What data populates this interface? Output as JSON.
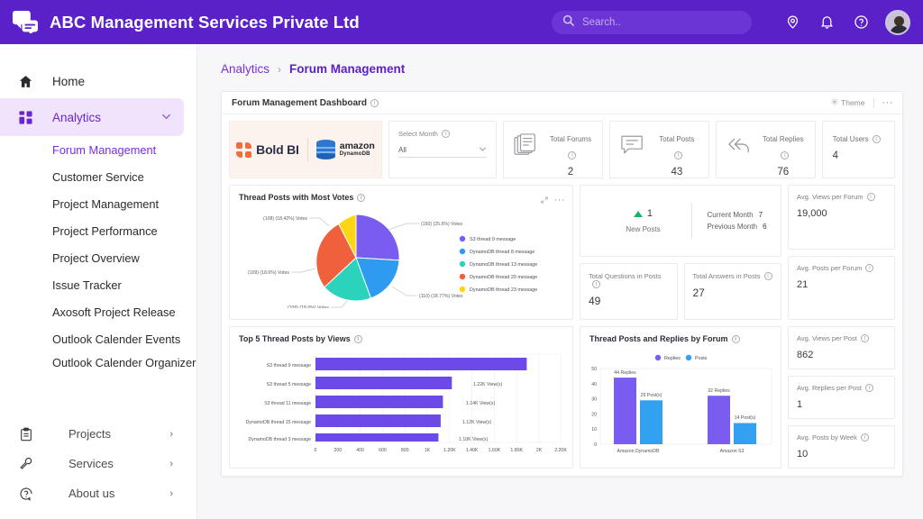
{
  "topbar": {
    "brand_title": "ABC Management Services Private Ltd",
    "search_placeholder": "Search..",
    "icons": [
      "location-pin-icon",
      "bell-icon",
      "help-icon"
    ]
  },
  "sidebar": {
    "home_label": "Home",
    "analytics_label": "Analytics",
    "sub_items": [
      "Forum Management",
      "Customer Service",
      "Project Management",
      "Project Performance",
      "Project Overview",
      "Issue Tracker",
      "Axosoft Project Release",
      "Outlook Calender Events",
      "Outlook Calender Organizer"
    ],
    "bottom_items": [
      "Projects",
      "Services",
      "About us"
    ]
  },
  "breadcrumb": {
    "parent": "Analytics",
    "separator": "›",
    "current": "Forum Management"
  },
  "dashboard": {
    "title": "Forum Management Dashboard",
    "theme_label": "Theme",
    "more_label": "···"
  },
  "kpi": {
    "logo_boldbi": "Bold BI",
    "logo_amazon": "amazon",
    "logo_dynamodb": "DynamoDB",
    "select_month_label": "Select Month",
    "select_month_value": "All",
    "cards": [
      {
        "label": "Total Forums",
        "value": "2",
        "icon": "documents-icon"
      },
      {
        "label": "Total Posts",
        "value": "43",
        "icon": "comment-icon"
      },
      {
        "label": "Total Replies",
        "value": "76",
        "icon": "reply-all-icon"
      },
      {
        "label": "Total Users",
        "value": "4",
        "icon": "none"
      }
    ]
  },
  "new_posts": {
    "value": "1",
    "label": "New Posts",
    "current_month_label": "Current Month",
    "current_month_value": "7",
    "previous_month_label": "Previous Month",
    "previous_month_value": "6"
  },
  "mini_cards": [
    {
      "label": "Total Questions in Posts",
      "value": "49"
    },
    {
      "label": "Total Answers in Posts",
      "value": "27"
    }
  ],
  "avg_cards": [
    {
      "label": "Avg. Views per Forum",
      "value": "19,000"
    },
    {
      "label": "Avg. Posts per Forum",
      "value": "21"
    },
    {
      "label": "Avg. Views per Post",
      "value": "862"
    },
    {
      "label": "Avg. Replies per Post",
      "value": "1"
    },
    {
      "label": "Avg. Posts by Week",
      "value": "10"
    }
  ],
  "chart_data": [
    {
      "type": "pie",
      "title": "Thread Posts with Most Votes",
      "labels": [
        "S3 thread 9 message",
        "DynamoDB thread 8 message",
        "DynamoDB thread 13 message",
        "DynamoDB thread 20 message",
        "DynamoDB thread 23 message"
      ],
      "values": [
        150,
        110,
        109,
        109,
        108
      ],
      "percents": [
        "25.6%",
        "18.77%",
        "18.6%",
        "18.6%",
        "18.42%"
      ],
      "point_labels": [
        "(150) (25.6%) Votes",
        "(110) (18.77%) Votes",
        "(109) (18.6%) Votes",
        "(109) (18.6%) Votes",
        "(108) (18.42%) Votes"
      ],
      "colors": [
        "#7b5cf0",
        "#2e9bf0",
        "#2bd3bd",
        "#f0603c",
        "#fcd613"
      ],
      "legend_position": "right"
    },
    {
      "type": "bar",
      "orientation": "horizontal",
      "title": "Top 5 Thread Posts by Views",
      "categories": [
        "S3 thread 9 message",
        "S3 thread 5 message",
        "S3 thread 11 message",
        "DynamoDB thread 15 message",
        "DynamoDB thread 3 message"
      ],
      "values": [
        1890,
        1220,
        1140,
        1120,
        1100
      ],
      "data_labels": [
        "",
        "1.22K View(s)",
        "1.14K View(s)",
        "1.12K View(s)",
        "1.10K View(s)"
      ],
      "xticks": [
        "0",
        "200",
        "400",
        "600",
        "800",
        "1K",
        "1.20K",
        "1.40K",
        "1.60K",
        "1.80K",
        "2K",
        "2.20K"
      ],
      "xlim": [
        0,
        2200
      ],
      "color": "#6c4ae8",
      "grid": true
    },
    {
      "type": "bar",
      "orientation": "vertical",
      "title": "Thread Posts and Replies by Forum",
      "categories": [
        "Amazon DynamoDB",
        "Amazon S3"
      ],
      "series": [
        {
          "name": "Replies",
          "values": [
            44,
            32
          ],
          "color": "#7b5cf0"
        },
        {
          "name": "Posts",
          "values": [
            29,
            14
          ],
          "color": "#33a1f2"
        }
      ],
      "data_labels": [
        [
          "44 Replies",
          "32 Replies"
        ],
        [
          "29 Post(s)",
          "14 Post(s)"
        ]
      ],
      "yticks": [
        "0",
        "10",
        "20",
        "30",
        "40",
        "50"
      ],
      "ylim": [
        0,
        50
      ],
      "legend_position": "top"
    }
  ]
}
